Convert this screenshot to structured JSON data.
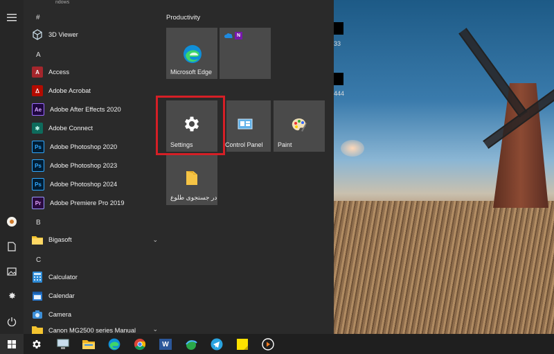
{
  "start_menu": {
    "clipped_top_text": "ndows",
    "letters": {
      "hash": "#",
      "a": "A",
      "b": "B",
      "c": "C"
    },
    "apps": [
      {
        "label": "3D Viewer",
        "icon": "cube-3d-icon"
      },
      {
        "label": "Access",
        "icon": "access-icon"
      },
      {
        "label": "Adobe Acrobat",
        "icon": "acrobat-icon"
      },
      {
        "label": "Adobe After Effects 2020",
        "icon": "after-effects-icon"
      },
      {
        "label": "Adobe Connect",
        "icon": "adobe-connect-icon"
      },
      {
        "label": "Adobe Photoshop 2020",
        "icon": "photoshop-icon"
      },
      {
        "label": "Adobe Photoshop 2023",
        "icon": "photoshop-icon"
      },
      {
        "label": "Adobe Photoshop 2024",
        "icon": "photoshop-icon"
      },
      {
        "label": "Adobe Premiere Pro 2019",
        "icon": "premiere-icon"
      },
      {
        "label": "Bigasoft",
        "icon": "folder-icon"
      },
      {
        "label": "Calculator",
        "icon": "calculator-icon"
      },
      {
        "label": "Calendar",
        "icon": "calendar-icon"
      },
      {
        "label": "Camera",
        "icon": "camera-icon"
      },
      {
        "label": "Canon MG2500 series Manual",
        "icon": "folder-icon"
      }
    ],
    "tiles": {
      "group_title": "Productivity",
      "edge": "Microsoft Edge",
      "settings": "Settings",
      "control_panel": "Control Panel",
      "paint": "Paint",
      "persian_folder": "در جستجوی طلوع"
    }
  },
  "desktop": {
    "icon_text_1": "33",
    "icon_text_2": "444"
  },
  "colors": {
    "highlight": "#d61f26",
    "accent_edge": "#0f8fd8"
  }
}
